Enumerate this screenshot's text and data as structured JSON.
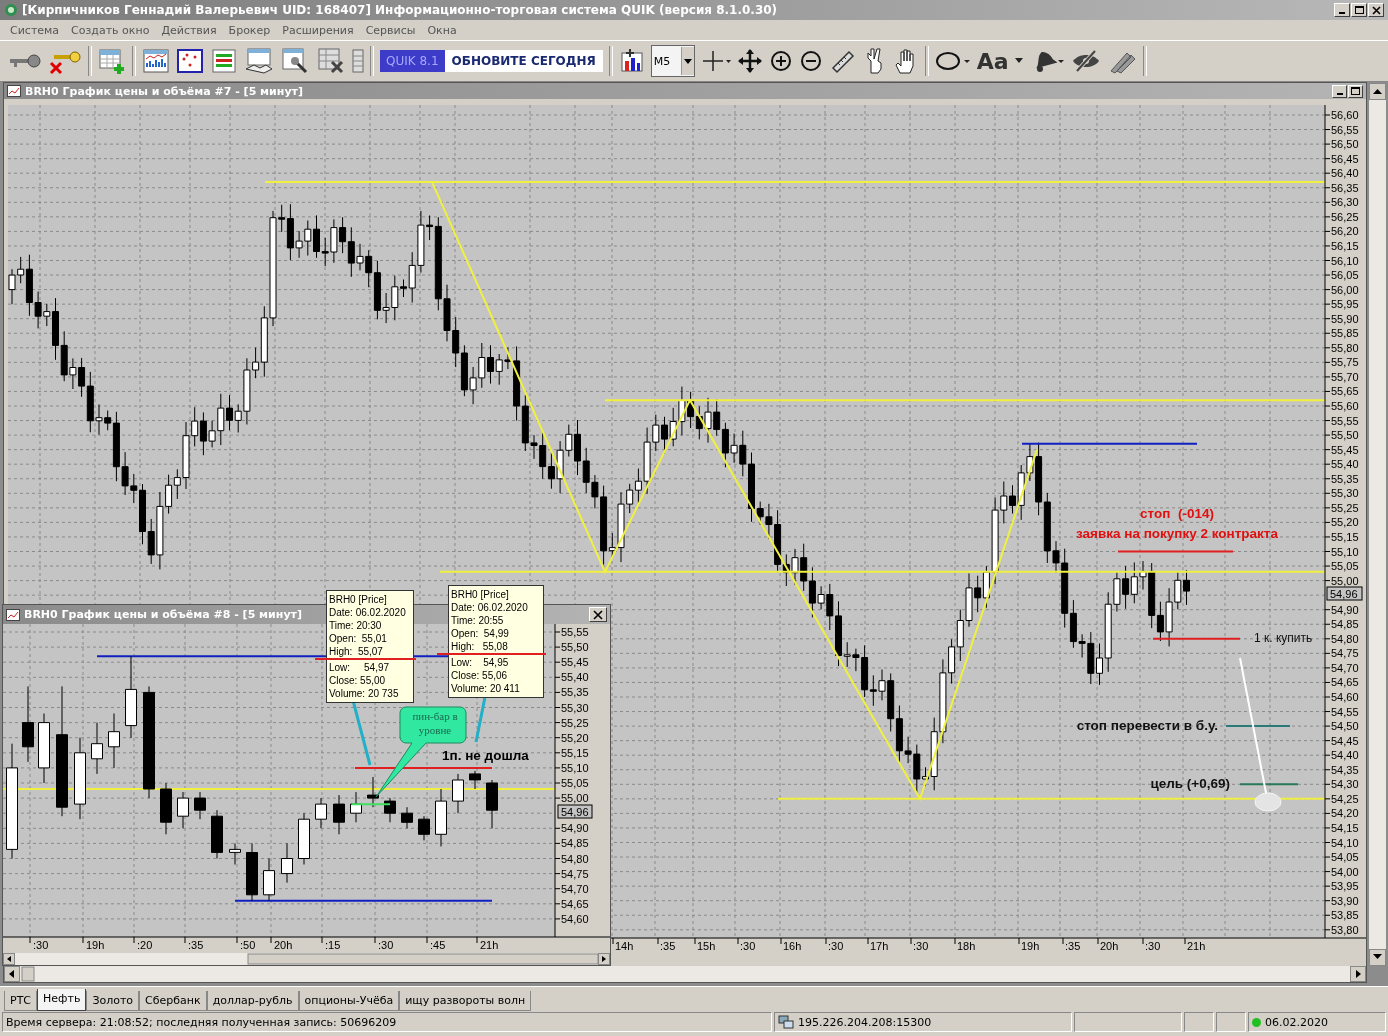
{
  "window": {
    "title": "[Кирпичников Геннадий Валерьевич UID: 168407] Информационно-торговая система QUIK (версия 8.1.0.30)"
  },
  "menu": [
    "Система",
    "Создать окно",
    "Действия",
    "Брокер",
    "Расширения",
    "Сервисы",
    "Окна"
  ],
  "toolbar": {
    "update_badge": {
      "version": "QUIK 8.1",
      "label": "ОБНОВИТЕ СЕГОДНЯ"
    },
    "interval": "M5",
    "font_button": "Aa"
  },
  "main_chart": {
    "title": "BRH0 График цены и объёма #7 - [5 минут]",
    "price_ticks": [
      "56,60",
      "56,55",
      "56,50",
      "56,45",
      "56,40",
      "56,35",
      "56,30",
      "56,25",
      "56,20",
      "56,15",
      "56,10",
      "56,05",
      "56,00",
      "55,95",
      "55,90",
      "55,85",
      "55,80",
      "55,75",
      "55,70",
      "55,65",
      "55,60",
      "55,55",
      "55,50",
      "55,45",
      "55,40",
      "55,35",
      "55,30",
      "55,25",
      "55,20",
      "55,15",
      "55,10",
      "55,05",
      "55,00",
      "54,90",
      "54,85",
      "54,80",
      "54,75",
      "54,70",
      "54,65",
      "54,60",
      "54,55",
      "54,50",
      "54,45",
      "54,40",
      "54,35",
      "54,30",
      "54,25",
      "54,20",
      "54,15",
      "54,10",
      "54,05",
      "54,00",
      "53,95",
      "53,90",
      "53,85",
      "53,80"
    ],
    "current_price": "54,96",
    "time_ticks": [
      "14h",
      ":35",
      "15h",
      ":30",
      "16h",
      ":30",
      "17h",
      ":30",
      "18h",
      "19h",
      ":35",
      "20h",
      ":30",
      "21h"
    ],
    "annotations": [
      {
        "kind": "order",
        "text": "стоп  (-014)"
      },
      {
        "kind": "order",
        "text": "заявка на покупку 2 контракта"
      },
      {
        "kind": "note",
        "text": "1 к. купить"
      },
      {
        "kind": "level",
        "text": "стоп перевести в б.у."
      },
      {
        "kind": "level",
        "text": "цель (+0,69)"
      }
    ]
  },
  "inset_chart": {
    "title": "BRH0 График цены и объёма #8 - [5 минут]",
    "price_ticks": [
      "55,55",
      "55,50",
      "55,45",
      "55,40",
      "55,35",
      "55,30",
      "55,25",
      "55,20",
      "55,15",
      "55,10",
      "55,05",
      "55,00",
      "54,90",
      "54,85",
      "54,80",
      "54,75",
      "54,70",
      "54,65",
      "54,60"
    ],
    "current_price": "54,96",
    "time_ticks": [
      ":30",
      "19h",
      ":20",
      ":35",
      ":50",
      "20h",
      ":15",
      ":30",
      ":45",
      "21h"
    ],
    "tooltips": [
      {
        "lines": [
          "BRH0 [Price]",
          "Date: 06.02.2020",
          "Time: 20:30",
          "Open:  55,01",
          "High:  55,07",
          "Low:     54,97",
          "Close: 55,00",
          "Volume: 20 735"
        ]
      },
      {
        "lines": [
          "BRH0 [Price]",
          "Date: 06.02.2020",
          "Time: 20:55",
          "Open:  54,99",
          "High:   55,08",
          "Low:    54,95",
          "Close: 55,06",
          "Volume: 20 411"
        ]
      }
    ],
    "callout": "пин-бар в уровне",
    "note": "1п. не дошла"
  },
  "tabs": [
    {
      "label": "РТС",
      "selected": false
    },
    {
      "label": "Нефть",
      "selected": true
    },
    {
      "label": "Золото",
      "selected": false
    },
    {
      "label": "Сбербанк",
      "selected": false
    },
    {
      "label": "доллар-рубль",
      "selected": false
    },
    {
      "label": "опционы-Учёба",
      "selected": false
    },
    {
      "label": "ищу развороты волн",
      "selected": false
    }
  ],
  "status_bar": {
    "server": "Время сервера: 21:08:52; последняя полученная запись: 50696209",
    "address": "195.226.204.208:15300",
    "date": "06.02.2020",
    "connected": true
  }
}
